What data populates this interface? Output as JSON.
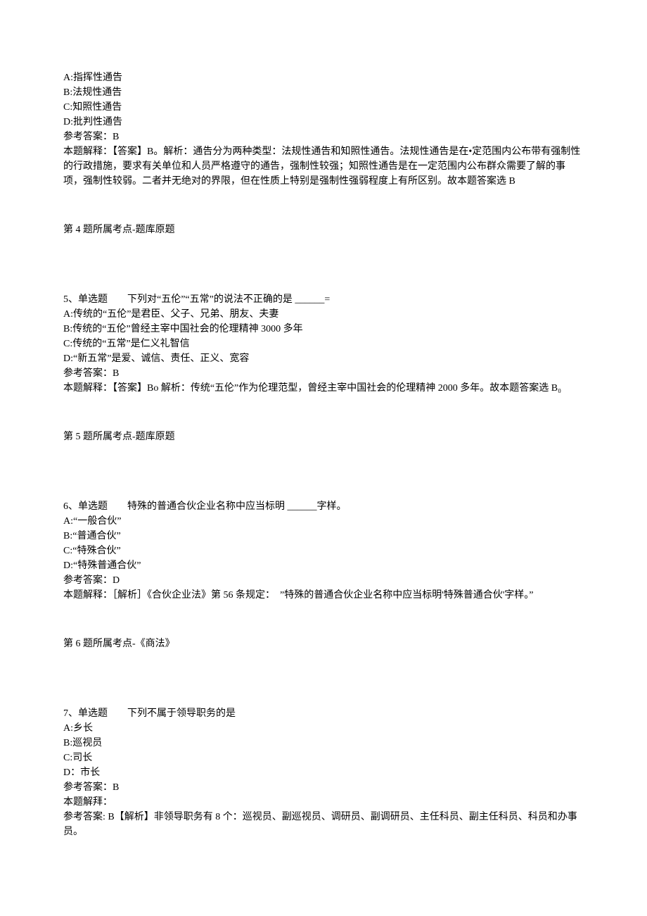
{
  "q4_partial": {
    "options": [
      "A:指挥性通告",
      "B:法规性通告",
      "C:知照性通告",
      "D:批判性通告"
    ],
    "ref_answer_label": "参考答案：B",
    "explanation": "本题解释：【答案】B。解析：通告分为两种类型：法规性通告和知照性通告。法规性通告是在•定范围内公布带有强制性的行政措施，要求有关单位和人员严格遵守的通告，强制性较强；知照性通告是在一定范围内公布群众需要了解的事项，强制性较弱。二者并无绝对的界限，但在性质上特别是强制性强弱程度上有所区别。故本题答案选 B",
    "topic": "第 4 题所属考点-题库原题"
  },
  "q5": {
    "stem": "5、单选题　　下列对“五伦”“五常”的说法不正确的是 ______=",
    "options": [
      "A:传统的“五伦”是君臣、父子、兄弟、朋友、夫妻",
      "B:传统的“五伦”曾经主宰中国社会的伦理精神 3000 多年",
      "C:传统的“五常”是仁义礼智信",
      "D:“新五常”是爱、诚信、责任、正义、宽容"
    ],
    "ref_answer_label": "参考答案：B",
    "explanation": "本题解释：【答案】Bo 解析：传统“五伦”作为伦理范型，曾经主宰中国社会的伦理精神 2000 多年。故本题答案选 B₀",
    "topic": "第 5 题所属考点-题库原题"
  },
  "q6": {
    "stem": "6、单选题　　特殊的普通合伙企业名称中应当标明 ______字样。",
    "options": [
      "A:“一般合伙”",
      "B:“普通合伙”",
      "C:“特殊合伙”",
      "D:“特殊普通合伙”"
    ],
    "ref_answer_label": "参考答案：D",
    "explanation": "本题解释：［解析］《合伙企业法》第 56 条规定：　”特殊的普通合伙企业名称中应当标明'特殊普通合伙'字样。”",
    "topic": "第 6 题所属考点-《商法》"
  },
  "q7": {
    "stem": "7、单选题　　下列不属于领导职务的是",
    "options": [
      "A:乡长",
      "B:巡视员",
      "C:司长",
      "D：市长"
    ],
    "ref_answer_label": "参考答案：B",
    "explanation_label": "本题解拜：",
    "explanation": "参考答案:  B【解析】非领导职务有 8 个：巡视员、副巡视员、调研员、副调研员、主任科员、副主任科员、科员和办事员。"
  }
}
